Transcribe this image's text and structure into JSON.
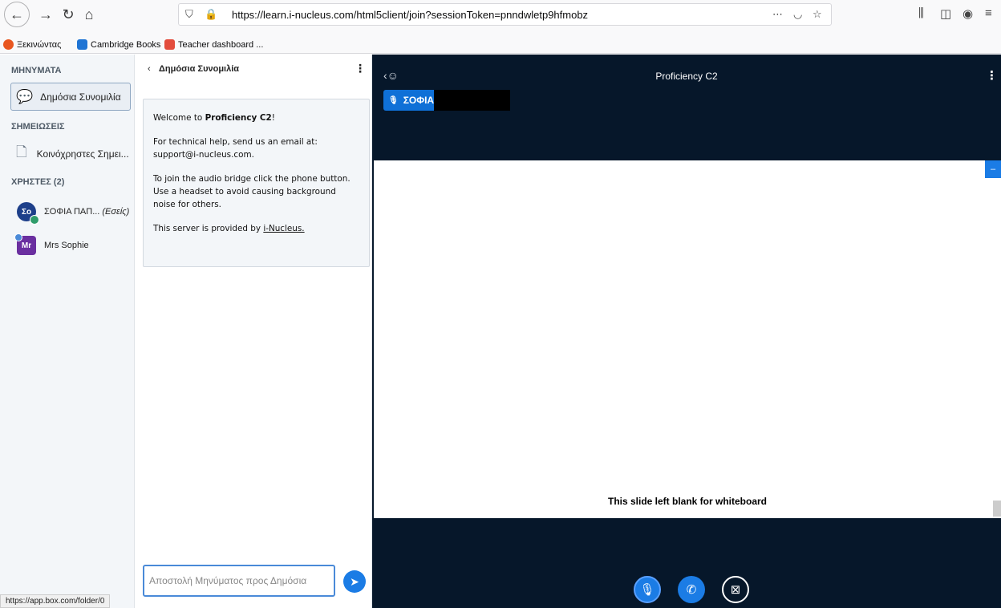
{
  "browser": {
    "url": "https://learn.i-nucleus.com/html5client/join?sessionToken=pnndwletp9hfmobz",
    "bookmarks": [
      {
        "label": "Ξεκινώντας",
        "color": "#e8561f"
      },
      {
        "label": "Cambridge Books",
        "color": "#1f74d4"
      },
      {
        "label": "Teacher dashboard ...",
        "color": "#e34c3c"
      }
    ],
    "status_url": "https://app.box.com/folder/0"
  },
  "userlist": {
    "messages_title": "ΜΗΝΥΜΑΤΑ",
    "public_chat_label": "Δημόσια Συνομιλία",
    "notes_title": "ΣΗΜΕΙΩΣΕΙΣ",
    "shared_notes_label": "Κοινόχρηστες Σημει...",
    "users_title": "ΧΡΗΣΤΕΣ (2)",
    "users": [
      {
        "initials": "Σο",
        "name": "ΣΟΦΙΑ ΠΑΠ...",
        "suffix": "(Εσείς)",
        "color": "#1d3f8a"
      },
      {
        "initials": "Mr",
        "name": "Mrs Sophie",
        "suffix": "",
        "color": "#6a2fa0"
      }
    ]
  },
  "chat": {
    "title": "Δημόσια Συνομιλία",
    "welcome": {
      "line1_prefix": "Welcome to ",
      "line1_name": "Proficiency C2",
      "line1_suffix": "!",
      "line2": "For technical help, send us an email at: support@i-nucleus.com.",
      "line3": "To join the audio bridge click the phone button. Use a headset to avoid causing background noise for others.",
      "line4_prefix": "This server is provided by ",
      "line4_link": "i-Nucleus."
    },
    "input_placeholder": "Αποστολή Μηνύματος προς Δημόσια"
  },
  "main": {
    "title": "Proficiency C2",
    "talker": "ΣΟΦΙΑ Π.",
    "slide_text": "This slide left blank for whiteboard"
  }
}
